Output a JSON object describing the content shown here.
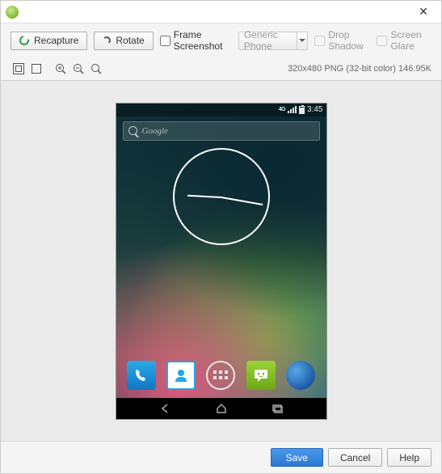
{
  "titlebar": {},
  "toolbar": {
    "recapture": "Recapture",
    "rotate": "Rotate",
    "frame_screenshot": "Frame Screenshot",
    "device_select": "Generic Phone",
    "drop_shadow": "Drop Shadow",
    "screen_glare": "Screen Glare"
  },
  "info": {
    "summary": "320x480 PNG (32-bit color) 146.95K"
  },
  "device": {
    "status": {
      "network": "4G",
      "time": "3:45"
    },
    "search_placeholder": "Google"
  },
  "footer": {
    "save": "Save",
    "cancel": "Cancel",
    "help": "Help"
  }
}
